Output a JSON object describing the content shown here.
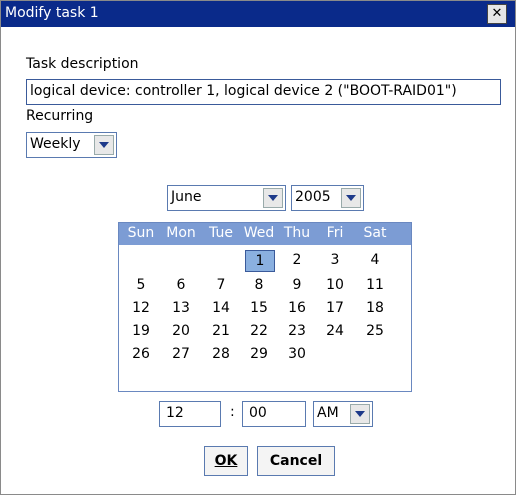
{
  "window": {
    "title": "Modify task 1",
    "close_glyph": "✕"
  },
  "task": {
    "description_label": "Task description",
    "description_value": "logical device: controller 1, logical device 2 (\"BOOT-RAID01\")",
    "recurring_label": "Recurring",
    "recurring_value": "Weekly"
  },
  "calendar": {
    "month": "June",
    "year": "2005",
    "weekdays": [
      "Sun",
      "Mon",
      "Tue",
      "Wed",
      "Thu",
      "Fri",
      "Sat"
    ],
    "weeks": [
      [
        "",
        "",
        "",
        "1",
        "2",
        "3",
        "4"
      ],
      [
        "5",
        "6",
        "7",
        "8",
        "9",
        "10",
        "11"
      ],
      [
        "12",
        "13",
        "14",
        "15",
        "16",
        "17",
        "18"
      ],
      [
        "19",
        "20",
        "21",
        "22",
        "23",
        "24",
        "25"
      ],
      [
        "26",
        "27",
        "28",
        "29",
        "30",
        "",
        ""
      ]
    ],
    "selected_day": "1",
    "header_color": "#7c9cd4",
    "selected_color": "#8ab0e0"
  },
  "time": {
    "hour": "12",
    "separator": ":",
    "minute": "00",
    "ampm": "AM"
  },
  "buttons": {
    "ok": "OK",
    "cancel": "Cancel"
  },
  "colors": {
    "titlebar": "#0a2a8a"
  }
}
